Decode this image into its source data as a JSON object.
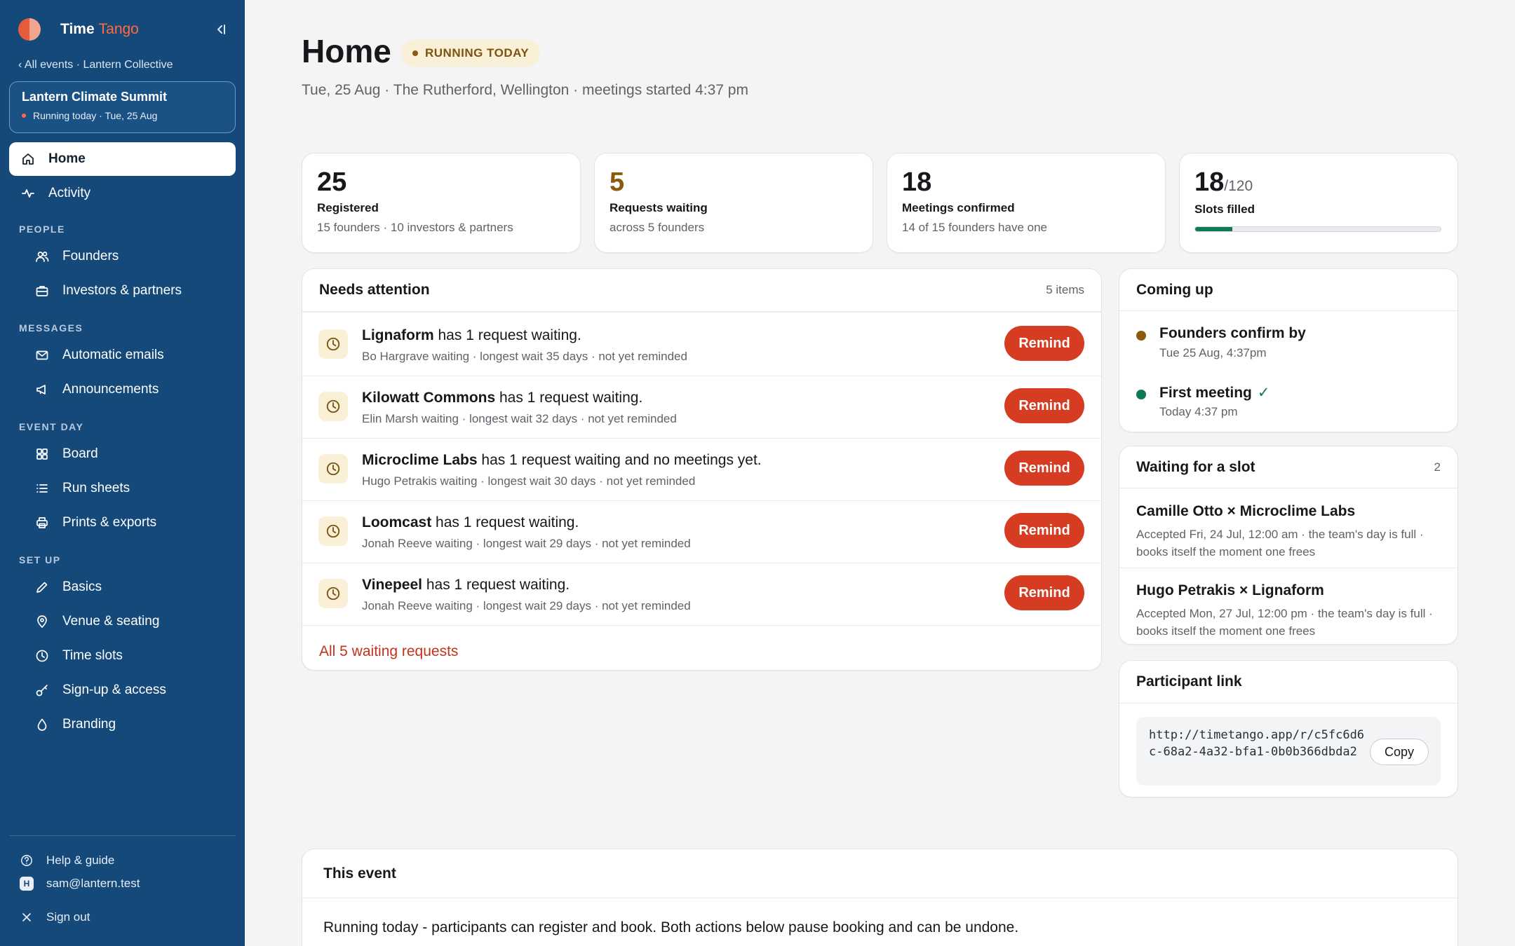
{
  "brand": {
    "name": "Time",
    "accent": "Tango"
  },
  "sidebar": {
    "back_link": "‹ All events · Lantern Collective",
    "event": {
      "name": "Lantern Climate Summit",
      "status": "Running today · Tue, 25 Aug"
    },
    "home": "Home",
    "activity": "Activity",
    "sections": {
      "people": "PEOPLE",
      "messages": "MESSAGES",
      "event_day": "EVENT DAY",
      "set_up": "SET UP"
    },
    "people": [
      "Founders",
      "Investors & partners"
    ],
    "messages": [
      "Automatic emails",
      "Announcements"
    ],
    "event_day": [
      "Board",
      "Run sheets",
      "Prints & exports"
    ],
    "set_up": [
      "Basics",
      "Venue & seating",
      "Time slots",
      "Sign-up & access",
      "Branding"
    ],
    "footer": {
      "help": "Help & guide",
      "avatar_letter": "H",
      "user": "sam@lantern.test",
      "sign_out": "Sign out"
    }
  },
  "header": {
    "title": "Home",
    "status": "RUNNING TODAY",
    "subtitle": "Tue, 25 Aug · The Rutherford, Wellington · meetings started 4:37 pm"
  },
  "stats": {
    "registered": {
      "value": "25",
      "label": "Registered",
      "desc": "15 founders · 10 investors & partners"
    },
    "requests": {
      "value": "5",
      "label": "Requests waiting",
      "desc": "across 5 founders"
    },
    "meetings": {
      "value": "18",
      "label": "Meetings confirmed",
      "desc": "14 of 15 founders have one"
    },
    "slots": {
      "value": "18",
      "total": "/120",
      "label": "Slots filled",
      "progress_fraction": 0.15
    }
  },
  "attention": {
    "title": "Needs attention",
    "count": "5 items",
    "remind_label": "Remind",
    "items": [
      {
        "name": "Lignaform",
        "text": " has 1 request waiting.",
        "sub": "Bo Hargrave waiting · longest wait 35 days · not yet reminded"
      },
      {
        "name": "Kilowatt Commons",
        "text": " has 1 request waiting.",
        "sub": "Elin Marsh waiting · longest wait 32 days · not yet reminded"
      },
      {
        "name": "Microclime Labs",
        "text": " has 1 request waiting and no meetings yet.",
        "sub": "Hugo Petrakis waiting · longest wait 30 days · not yet reminded"
      },
      {
        "name": "Loomcast",
        "text": " has 1 request waiting.",
        "sub": "Jonah Reeve waiting · longest wait 29 days · not yet reminded"
      },
      {
        "name": "Vinepeel",
        "text": " has 1 request waiting.",
        "sub": "Jonah Reeve waiting · longest wait 29 days · not yet reminded"
      }
    ],
    "footer_link": "All 5 waiting requests"
  },
  "coming_up": {
    "title": "Coming up",
    "items": [
      {
        "title": "Founders confirm by",
        "sub": "Tue 25 Aug, 4:37pm",
        "color": "#8a5a0e",
        "check": ""
      },
      {
        "title": "First meeting",
        "sub": "Today 4:37 pm",
        "color": "#0e7a55",
        "check": "✓"
      }
    ]
  },
  "waiting": {
    "title": "Waiting for a slot",
    "count": "2",
    "items": [
      {
        "title": "Camille Otto × Microclime Labs",
        "sub": "Accepted Fri, 24 Jul, 12:00 am · the team's day is full · books itself the moment one frees"
      },
      {
        "title": "Hugo Petrakis × Lignaform",
        "sub": "Accepted Mon, 27 Jul, 12:00 pm · the team's day is full · books itself the moment one frees"
      }
    ]
  },
  "participant_link": {
    "title": "Participant link",
    "url": "http://timetango.app/r/c5fc6d6c-68a2-4a32-bfa1-0b0b366dbda2",
    "copy_label": "Copy"
  },
  "this_event": {
    "title": "This event",
    "body": "Running today - participants can register and book. Both actions below pause booking and can be undone."
  }
}
